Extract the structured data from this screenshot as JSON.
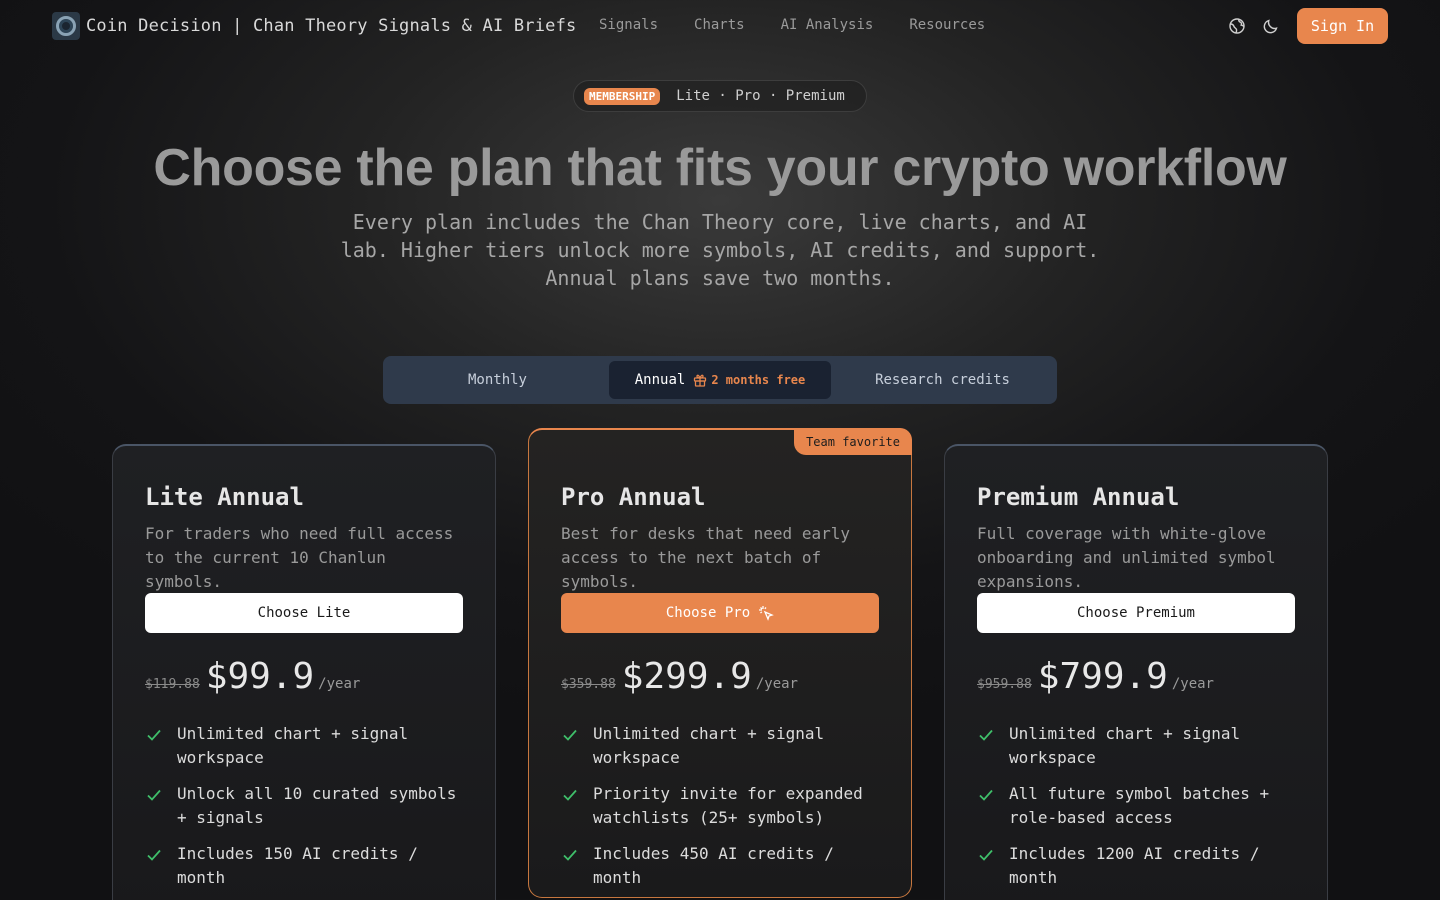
{
  "nav": {
    "brand": "Coin Decision | Chan Theory Signals & AI Briefs",
    "links": [
      "Signals",
      "Charts",
      "AI Analysis",
      "Resources"
    ],
    "signin_label": "Sign In"
  },
  "hero": {
    "badge": "MEMBERSHIP",
    "tiers": "Lite · Pro · Premium",
    "title": "Choose the plan that fits your crypto workflow",
    "subtitle": "Every plan includes the Chan Theory core, live charts, and AI lab. Higher tiers unlock more symbols, AI credits, and support. Annual plans save two months."
  },
  "billing": {
    "options": [
      "Monthly",
      "Annual",
      "Research credits"
    ],
    "selected": "Annual",
    "free_badge": "2 months free"
  },
  "colors": {
    "accent": "#e8864d",
    "check": "#3fbf6a",
    "toggle_bg": "#2f3a4b"
  },
  "plans": [
    {
      "title": "Lite Annual",
      "description": "For traders who need full access to the current 10 Chanlun symbols.",
      "button": "Choose Lite",
      "old_price": "$119.88",
      "price": "$99.9",
      "period": "/year",
      "features": [
        "Unlimited chart + signal workspace",
        "Unlock all 10 curated symbols + signals",
        "Includes 150 AI credits / month"
      ]
    },
    {
      "title": "Pro Annual",
      "ribbon": "Team favorite",
      "description": "Best for desks that need early access to the next batch of symbols.",
      "button": "Choose Pro",
      "old_price": "$359.88",
      "price": "$299.9",
      "period": "/year",
      "features": [
        "Unlimited chart + signal workspace",
        "Priority invite for expanded watchlists (25+ symbols)",
        "Includes 450 AI credits / month"
      ]
    },
    {
      "title": "Premium Annual",
      "description": "Full coverage with white-glove onboarding and unlimited symbol expansions.",
      "button": "Choose Premium",
      "old_price": "$959.88",
      "price": "$799.9",
      "period": "/year",
      "features": [
        "Unlimited chart + signal workspace",
        "All future symbol batches + role-based access",
        "Includes 1200 AI credits / month"
      ]
    }
  ]
}
